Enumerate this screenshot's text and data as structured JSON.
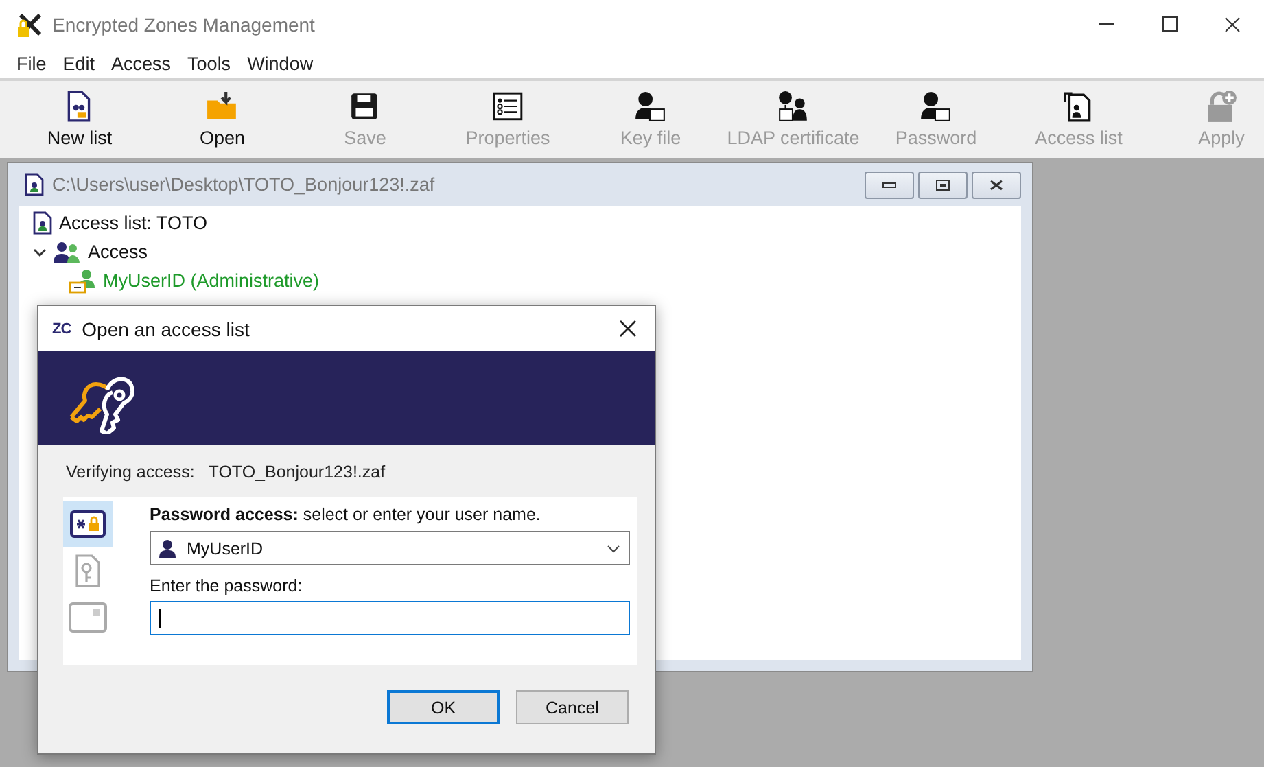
{
  "window": {
    "title": "Encrypted Zones Management"
  },
  "menu": [
    "File",
    "Edit",
    "Access",
    "Tools",
    "Window"
  ],
  "toolbar": {
    "groups": [
      [
        {
          "label": "New list",
          "disabled": false
        },
        {
          "label": "Open",
          "disabled": false
        },
        {
          "label": "Save",
          "disabled": true
        },
        {
          "label": "Properties",
          "disabled": true
        }
      ],
      [
        {
          "label": "Key file",
          "disabled": true
        },
        {
          "label": "LDAP certificate",
          "disabled": true
        },
        {
          "label": "Password",
          "disabled": true
        },
        {
          "label": "Access list",
          "disabled": true
        }
      ],
      [
        {
          "label": "Apply",
          "disabled": true
        }
      ]
    ]
  },
  "child_window": {
    "title": "C:\\Users\\user\\Desktop\\TOTO_Bonjour123!.zaf",
    "tree": [
      {
        "label": "Access list: TOTO",
        "kind": "list"
      },
      {
        "label": "Access",
        "kind": "group",
        "expanded": true,
        "children": [
          {
            "label": "MyUserID (Administrative)",
            "kind": "admin"
          }
        ]
      }
    ]
  },
  "dialog": {
    "logo": "ZC",
    "title": "Open an access list",
    "verifying_label": "Verifying access:",
    "file": "TOTO_Bonjour123!.zaf",
    "methods": [
      {
        "selected": true
      },
      {
        "selected": false
      },
      {
        "selected": false
      }
    ],
    "heading": "**Password access:** select or enter your user name.",
    "user": "MyUserID",
    "password_label": "Enter the password:",
    "password_focused": true,
    "buttons": [
      {
        "label": "OK",
        "default": true
      },
      {
        "label": "Cancel",
        "default": false
      }
    ]
  }
}
